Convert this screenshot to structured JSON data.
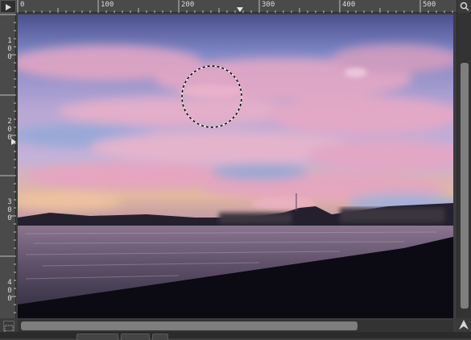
{
  "rulers": {
    "horizontal_labels": [
      "0",
      "100",
      "200",
      "300",
      "400",
      "500"
    ],
    "vertical_labels": [
      "100",
      "200",
      "300",
      "400"
    ]
  },
  "icons": {
    "menu": "triangle-right-icon",
    "zoom": "zoom-icon",
    "navigate": "navigate-icon",
    "quick_mask": "quick-mask-icon"
  },
  "colors": {
    "ruler_bg": "#4a4a4a",
    "ui_bg": "#3c3c3c",
    "scroll_thumb": "#7e7e7e",
    "selection_marching_ants": "#ffffff",
    "sky_top": "#5a5a9a",
    "sky_pink": "#e8a6c0",
    "sky_blue": "#8fa6d6",
    "water": "#6a5a74",
    "shore": "#0c0a12"
  },
  "canvas": {
    "selection_shape": "ellipse",
    "image_subject": "sunset-sky-over-water"
  }
}
